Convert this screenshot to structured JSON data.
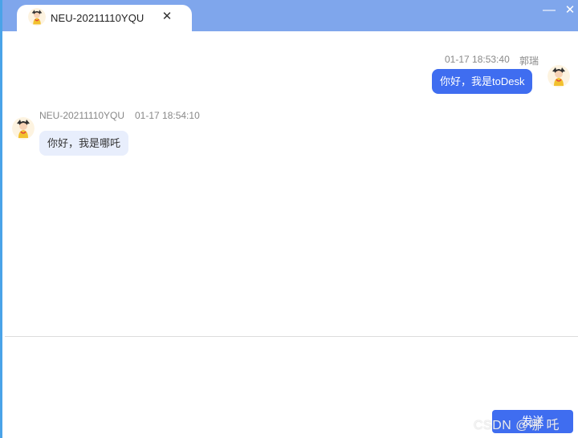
{
  "tab": {
    "title": "NEU-20211110YQU",
    "close_glyph": "✕"
  },
  "window_controls": {
    "minimize_glyph": "—",
    "close_glyph": "✕"
  },
  "messages": [
    {
      "direction": "outgoing",
      "time": "01-17 18:53:40",
      "sender": "郭瑞",
      "text": "你好，我是toDesk",
      "avatar_icon": "cartoon-avatar-icon"
    },
    {
      "direction": "incoming",
      "sender": "NEU-20211110YQU",
      "time": "01-17 18:54:10",
      "text": "你好，我是哪吒",
      "avatar_icon": "cartoon-avatar-icon"
    }
  ],
  "composer": {
    "send_label": "发送"
  },
  "watermark": "CSDN @哪 吒",
  "colors": {
    "titlebar": "#7fa6ec",
    "accent": "#3f6df0",
    "incoming_bubble": "#e8eefc"
  }
}
